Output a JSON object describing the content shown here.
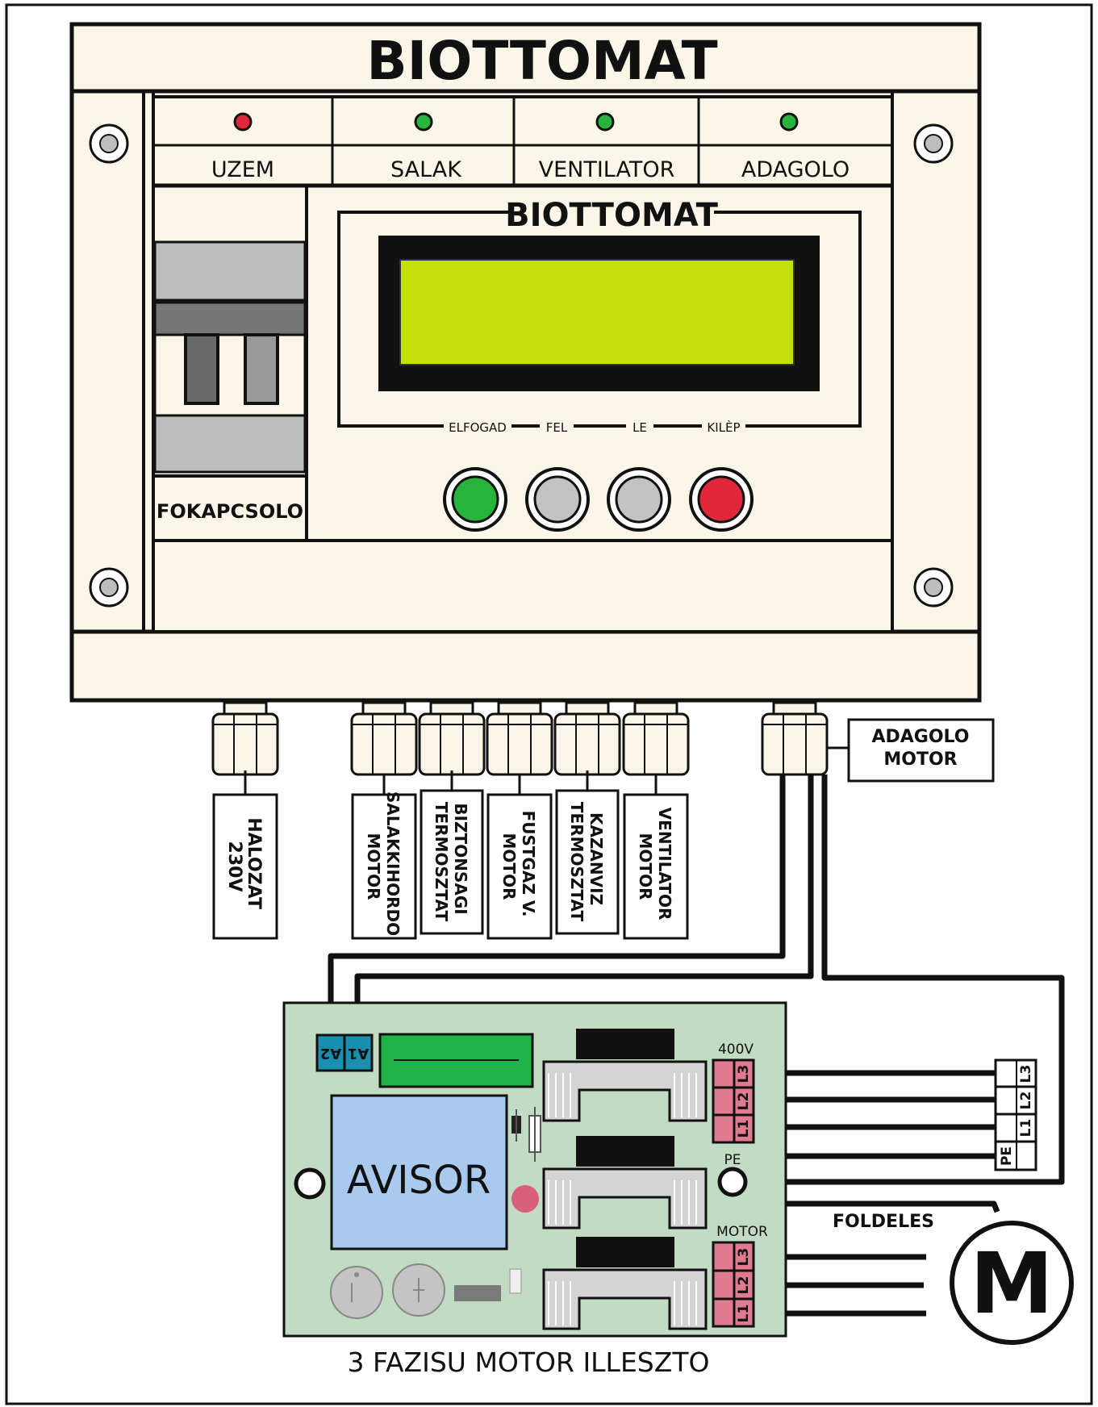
{
  "controller": {
    "title": "BIOTTOMAT",
    "display_brand": "BIOTTOMAT",
    "indicators": [
      {
        "label": "UZEM",
        "color": "#e0283a"
      },
      {
        "label": "SALAK",
        "color": "#28b43c"
      },
      {
        "label": "VENTILATOR",
        "color": "#28b43c"
      },
      {
        "label": "ADAGOLO",
        "color": "#28b43c"
      }
    ],
    "main_switch_label": "FOKAPCSOLO",
    "lcd_color": "#c4e00a",
    "buttons": [
      {
        "label": "ELFOGAD",
        "color": "#28b43c"
      },
      {
        "label": "FEL",
        "color": "#c2c2c2"
      },
      {
        "label": "LE",
        "color": "#c2c2c2"
      },
      {
        "label": "KILÈP",
        "color": "#e0283a"
      }
    ]
  },
  "connections": {
    "mains": [
      "HALOZAT",
      "230V"
    ],
    "slag_motor": [
      "SALAKKIHORDO",
      "MOTOR"
    ],
    "safety_thermostat": [
      "BIZTONSAGI",
      "TERMOSZTAT"
    ],
    "flue_motor": [
      "FUSTGAZ V.",
      "MOTOR"
    ],
    "boiler_thermostat": [
      "KAZANVIZ",
      "TERMOSZTAT"
    ],
    "fan_motor": [
      "VENTILATOR",
      "MOTOR"
    ],
    "feeder_motor": [
      "ADAGOLO",
      "MOTOR"
    ]
  },
  "module": {
    "title": "3 FAZISU MOTOR ILLESZTO",
    "brand": "AVISOR",
    "input_terminals": [
      "A2",
      "A1"
    ],
    "supply_label": "400V",
    "supply_terminals": [
      "L3",
      "L2",
      "L1"
    ],
    "pe_label": "PE",
    "motor_label": "MOTOR",
    "motor_terminals": [
      "L3",
      "L2",
      "L1"
    ],
    "board_color": "#c2dcc4"
  },
  "mains_terminals": [
    "L3",
    "L2",
    "L1",
    "PE"
  ],
  "earth_label": "FOLDELES",
  "motor_symbol": "M"
}
